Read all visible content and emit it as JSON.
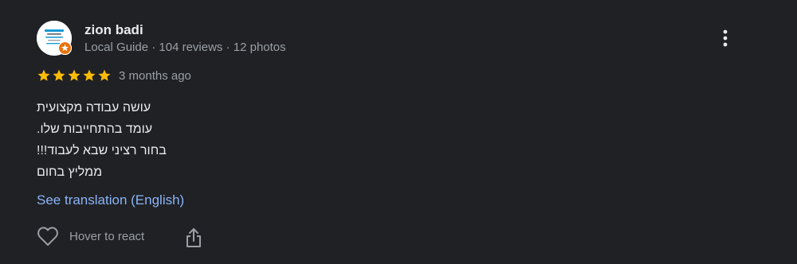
{
  "reviewer": {
    "name": "zion badi",
    "meta": "Local Guide · 104 reviews · 12 photos",
    "avatar_icon": "business-logo-avatar",
    "badge_icon": "local-guide-star-badge"
  },
  "rating": {
    "stars": 5,
    "max": 5,
    "color": "#fbbc04"
  },
  "time": "3 months ago",
  "review_lines": [
    "עושה עבודה מקצועית",
    "עומד בהתחייבות שלו.",
    "בחור רציני שבא לעבוד!!!",
    "ממליץ בחום"
  ],
  "translation_link": "See translation (English)",
  "actions": {
    "react_label": "Hover to react",
    "react_icon": "heart-outline-icon",
    "share_icon": "share-icon",
    "menu_icon": "more-vert-icon"
  },
  "colors": {
    "background": "#202124",
    "primary_text": "#e8eaed",
    "secondary_text": "#9aa0a6",
    "link": "#8ab4f8",
    "badge": "#e8710a"
  }
}
